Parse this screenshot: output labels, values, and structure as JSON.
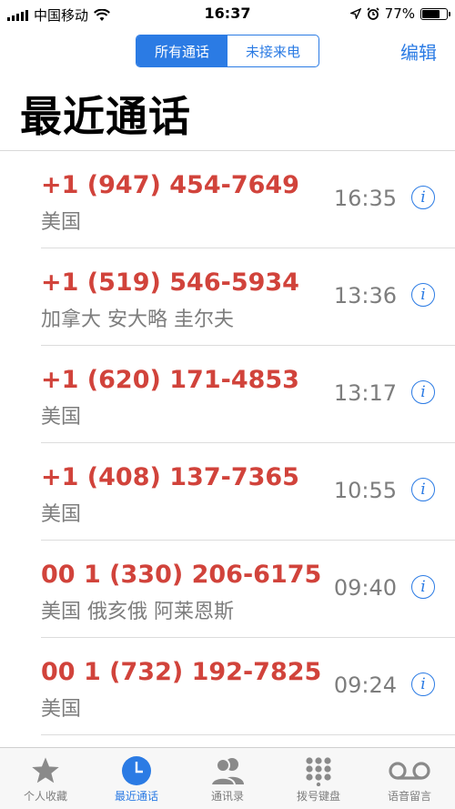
{
  "status_bar": {
    "carrier": "中国移动",
    "time": "16:37",
    "battery_pct": "77%",
    "battery_level": 0.77
  },
  "header": {
    "segments": [
      "所有通话",
      "未接来电"
    ],
    "active_segment": 0,
    "edit_label": "编辑",
    "title": "最近通话"
  },
  "calls": [
    {
      "number": "+1 (947) 454-7649",
      "location": "美国",
      "time": "16:35"
    },
    {
      "number": "+1 (519) 546-5934",
      "location": "加拿大 安大略 圭尔夫",
      "time": "13:36"
    },
    {
      "number": "+1 (620) 171-4853",
      "location": "美国",
      "time": "13:17"
    },
    {
      "number": "+1 (408) 137-7365",
      "location": "美国",
      "time": "10:55"
    },
    {
      "number": "00 1 (330) 206-6175",
      "location": "美国 俄亥俄 阿莱恩斯",
      "time": "09:40"
    },
    {
      "number": "00 1 (732) 192-7825",
      "location": "美国",
      "time": "09:24"
    }
  ],
  "tabs": [
    {
      "label": "个人收藏",
      "icon": "star-icon"
    },
    {
      "label": "最近通话",
      "icon": "clock-icon"
    },
    {
      "label": "通讯录",
      "icon": "contacts-icon"
    },
    {
      "label": "拨号键盘",
      "icon": "keypad-icon"
    },
    {
      "label": "语音留言",
      "icon": "voicemail-icon"
    }
  ],
  "active_tab": 1,
  "colors": {
    "accent": "#2b7be4",
    "missed_call": "#d1433b",
    "secondary_text": "#7d7d7d"
  }
}
